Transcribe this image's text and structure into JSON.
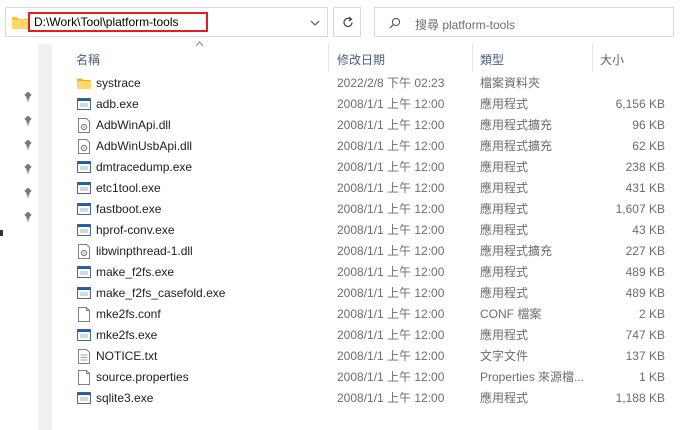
{
  "address_bar": {
    "path": "D:\\Work\\Tool\\platform-tools"
  },
  "search": {
    "placeholder": "搜尋 platform-tools"
  },
  "columns": {
    "name": "名稱",
    "date": "修改日期",
    "type": "類型",
    "size": "大小"
  },
  "files": [
    {
      "name": "systrace",
      "date": "2022/2/8 下午 02:23",
      "type": "檔案資料夾",
      "size": "",
      "icon": "folder-icon"
    },
    {
      "name": "adb.exe",
      "date": "2008/1/1 上午 12:00",
      "type": "應用程式",
      "size": "6,156 KB",
      "icon": "exe-icon"
    },
    {
      "name": "AdbWinApi.dll",
      "date": "2008/1/1 上午 12:00",
      "type": "應用程式擴充",
      "size": "96 KB",
      "icon": "dll-icon"
    },
    {
      "name": "AdbWinUsbApi.dll",
      "date": "2008/1/1 上午 12:00",
      "type": "應用程式擴充",
      "size": "62 KB",
      "icon": "dll-icon"
    },
    {
      "name": "dmtracedump.exe",
      "date": "2008/1/1 上午 12:00",
      "type": "應用程式",
      "size": "238 KB",
      "icon": "exe-icon"
    },
    {
      "name": "etc1tool.exe",
      "date": "2008/1/1 上午 12:00",
      "type": "應用程式",
      "size": "431 KB",
      "icon": "exe-icon"
    },
    {
      "name": "fastboot.exe",
      "date": "2008/1/1 上午 12:00",
      "type": "應用程式",
      "size": "1,607 KB",
      "icon": "exe-icon"
    },
    {
      "name": "hprof-conv.exe",
      "date": "2008/1/1 上午 12:00",
      "type": "應用程式",
      "size": "43 KB",
      "icon": "exe-icon"
    },
    {
      "name": "libwinpthread-1.dll",
      "date": "2008/1/1 上午 12:00",
      "type": "應用程式擴充",
      "size": "227 KB",
      "icon": "dll-icon"
    },
    {
      "name": "make_f2fs.exe",
      "date": "2008/1/1 上午 12:00",
      "type": "應用程式",
      "size": "489 KB",
      "icon": "exe-icon"
    },
    {
      "name": "make_f2fs_casefold.exe",
      "date": "2008/1/1 上午 12:00",
      "type": "應用程式",
      "size": "489 KB",
      "icon": "exe-icon"
    },
    {
      "name": "mke2fs.conf",
      "date": "2008/1/1 上午 12:00",
      "type": "CONF 檔案",
      "size": "2 KB",
      "icon": "file-icon"
    },
    {
      "name": "mke2fs.exe",
      "date": "2008/1/1 上午 12:00",
      "type": "應用程式",
      "size": "747 KB",
      "icon": "exe-icon"
    },
    {
      "name": "NOTICE.txt",
      "date": "2008/1/1 上午 12:00",
      "type": "文字文件",
      "size": "137 KB",
      "icon": "text-file-icon"
    },
    {
      "name": "source.properties",
      "date": "2008/1/1 上午 12:00",
      "type": "Properties 來源檔...",
      "size": "1 KB",
      "icon": "file-icon"
    },
    {
      "name": "sqlite3.exe",
      "date": "2008/1/1 上午 12:00",
      "type": "應用程式",
      "size": "1,188 KB",
      "icon": "exe-icon"
    }
  ],
  "colors": {
    "highlight_box": "#e01f1f",
    "folder": "#f4c542",
    "exe_accent": "#1f5fa8",
    "header_text": "#4c607a"
  }
}
